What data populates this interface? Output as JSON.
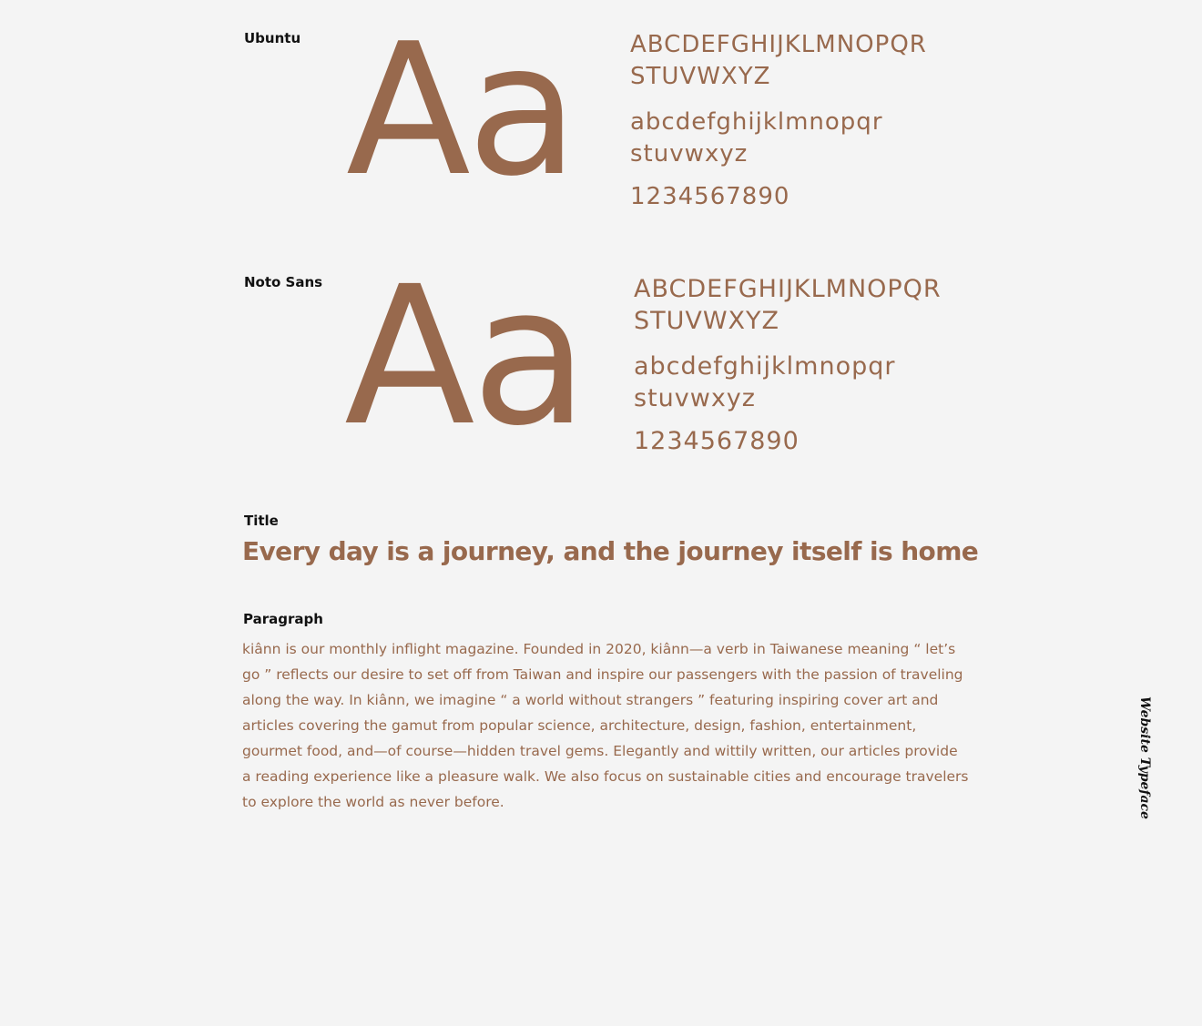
{
  "typefaces": [
    {
      "name": "Ubuntu",
      "sample": "Aa",
      "uppercase_line1": "ABCDEFGHIJKLMNOPQR",
      "uppercase_line2": "STUVWXYZ",
      "lowercase_line1": "abcdefghijklmnopqr",
      "lowercase_line2": "stuvwxyz",
      "digits": "1234567890"
    },
    {
      "name": "Noto Sans",
      "sample": "Aa",
      "uppercase_line1": "ABCDEFGHIJKLMNOPQR",
      "uppercase_line2": "STUVWXYZ",
      "lowercase_line1": "abcdefghijklmnopqr",
      "lowercase_line2": "stuvwxyz",
      "digits": "1234567890"
    }
  ],
  "title_section": {
    "label": "Title",
    "sample": "Every day is a journey, and the journey itself is home"
  },
  "paragraph_section": {
    "label": "Paragraph",
    "sample": "kiânn is our monthly inflight magazine. Founded in 2020, kiânn—a verb in Taiwanese meaning “ let’s go ” reflects our desire to set off from Taiwan and inspire our passengers with the passion of traveling along the way. In kiânn, we imagine “ a world without strangers ” featuring inspiring cover art and articles covering the gamut from popular science, architecture, design, fashion, entertainment, gourmet food, and—of course—hidden travel gems. Elegantly and wittily written, our articles provide a reading experience like a pleasure walk. We also focus on sustainable cities and encourage travelers to explore the world as never before."
  },
  "side_title": "Website Typeface",
  "colors": {
    "background": "#f4f4f4",
    "accent_brown": "#98694d",
    "label_text": "#111111"
  }
}
